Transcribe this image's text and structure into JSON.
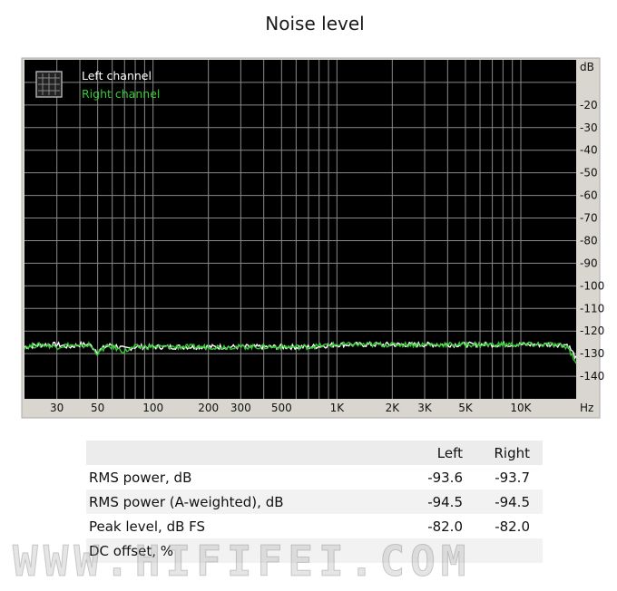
{
  "title": "Noise level",
  "chart_data": {
    "type": "line",
    "x_scale": "log",
    "xlim": [
      20,
      20000
    ],
    "ylim": [
      -150,
      0
    ],
    "xticks": [
      30,
      50,
      100,
      200,
      300,
      500,
      1000,
      2000,
      3000,
      5000,
      10000
    ],
    "xtick_labels": [
      "30",
      "50",
      "100",
      "200",
      "300",
      "500",
      "1K",
      "2K",
      "3K",
      "5K",
      "10K"
    ],
    "yticks": [
      -20,
      -30,
      -40,
      -50,
      -60,
      -70,
      -80,
      -90,
      -100,
      -110,
      -120,
      -130,
      -140
    ],
    "ytick_labels": [
      "-20",
      "-30",
      "-40",
      "-50",
      "-60",
      "-70",
      "-80",
      "-90",
      "-100",
      "-110",
      "-120",
      "-130",
      "-140"
    ],
    "ylabel": "dB",
    "xlabel": "Hz",
    "grid": true,
    "background": "#000000",
    "legend_position": "top-left",
    "series": [
      {
        "name": "Left channel",
        "color": "#ffffff",
        "x": [
          20,
          25,
          30,
          35,
          40,
          45,
          50,
          55,
          60,
          70,
          80,
          100,
          150,
          200,
          300,
          500,
          700,
          1000,
          2000,
          3000,
          5000,
          7000,
          10000,
          15000,
          18000,
          20000
        ],
        "y": [
          -127,
          -126,
          -126,
          -127,
          -126,
          -126,
          -129,
          -127,
          -126,
          -128,
          -127,
          -127,
          -127,
          -127,
          -127,
          -127,
          -127,
          -126,
          -126,
          -126,
          -126,
          -126,
          -126,
          -126,
          -126,
          -132
        ]
      },
      {
        "name": "Right channel",
        "color": "#33cc33",
        "x": [
          20,
          25,
          30,
          35,
          40,
          45,
          50,
          55,
          60,
          70,
          80,
          100,
          150,
          200,
          300,
          500,
          700,
          1000,
          2000,
          3000,
          5000,
          7000,
          10000,
          15000,
          18000,
          20000
        ],
        "y": [
          -127,
          -126,
          -127,
          -126,
          -127,
          -126,
          -130,
          -127,
          -127,
          -129,
          -127,
          -127,
          -127,
          -127,
          -127,
          -127,
          -127,
          -126,
          -126,
          -126,
          -126,
          -126,
          -126,
          -126,
          -127,
          -134
        ]
      }
    ]
  },
  "stats": {
    "headers": [
      "",
      "Left",
      "Right"
    ],
    "rows": [
      [
        "RMS power, dB",
        "-93.6",
        "-93.7"
      ],
      [
        "RMS power (A-weighted), dB",
        "-94.5",
        "-94.5"
      ],
      [
        "Peak level, dB FS",
        "-82.0",
        "-82.0"
      ],
      [
        "DC offset, %",
        "",
        ""
      ]
    ]
  },
  "watermark": "WWW.HIFIFEI.COM"
}
